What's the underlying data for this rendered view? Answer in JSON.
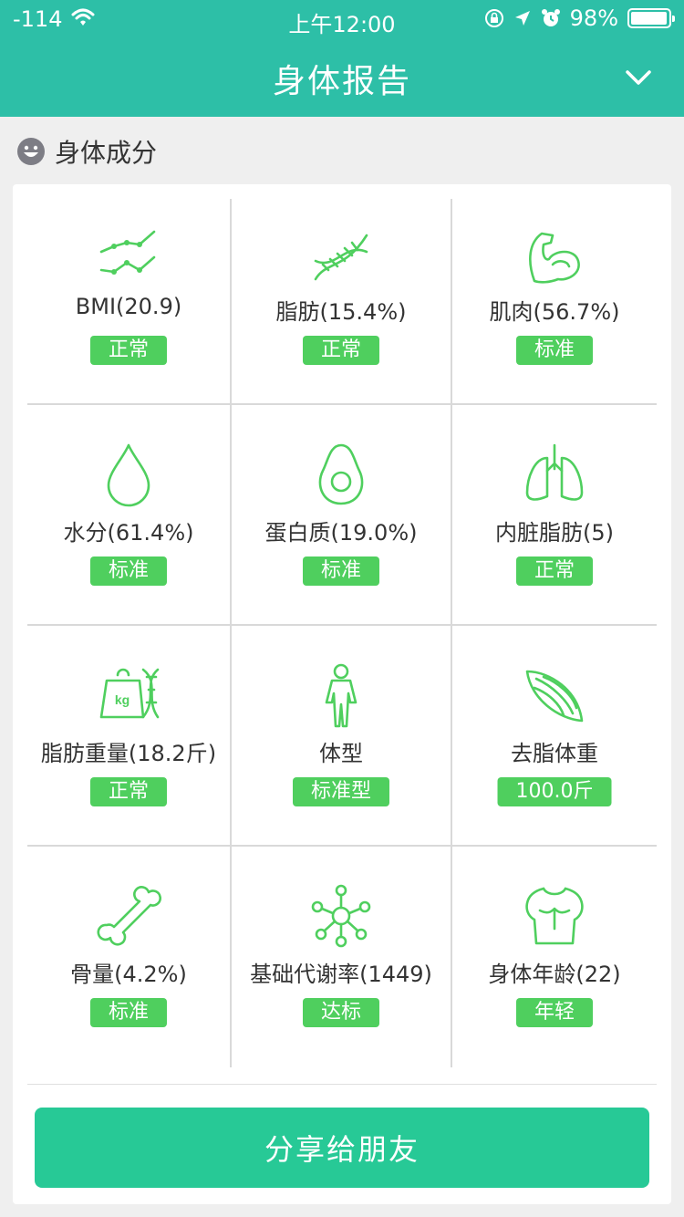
{
  "status_bar": {
    "signal": "-114",
    "time": "上午12:00",
    "battery": "98%",
    "battery_level": 0.98
  },
  "nav": {
    "title": "身体报告",
    "chevron_icon": "chevron-down-icon"
  },
  "section": {
    "icon": "smiley-face-icon",
    "title": "身体成分"
  },
  "metrics": [
    {
      "icon": "trend-lines-icon",
      "label": "BMI(20.9)",
      "badge": "正常"
    },
    {
      "icon": "dna-icon",
      "label": "脂肪(15.4%)",
      "badge": "正常"
    },
    {
      "icon": "muscle-arm-icon",
      "label": "肌肉(56.7%)",
      "badge": "标准"
    },
    {
      "icon": "water-drop-icon",
      "label": "水分(61.4%)",
      "badge": "标准"
    },
    {
      "icon": "avocado-icon",
      "label": "蛋白质(19.0%)",
      "badge": "标准"
    },
    {
      "icon": "lungs-icon",
      "label": "内脏脂肪(5)",
      "badge": "正常"
    },
    {
      "icon": "kg-weight-dna-icon",
      "label": "脂肪重量(18.2斤)",
      "badge": "正常",
      "icon_text": "kg"
    },
    {
      "icon": "body-figure-icon",
      "label": "体型",
      "badge": "标准型"
    },
    {
      "icon": "muscle-fiber-icon",
      "label": "去脂体重",
      "badge": "100.0斤"
    },
    {
      "icon": "bone-icon",
      "label": "骨量(4.2%)",
      "badge": "标准"
    },
    {
      "icon": "molecule-icon",
      "label": "基础代谢率(1449)",
      "badge": "达标"
    },
    {
      "icon": "torso-icon",
      "label": "身体年龄(22)",
      "badge": "年轻"
    }
  ],
  "share_button": {
    "label": "分享给朋友"
  },
  "colors": {
    "header": "#2dbfa7",
    "badge": "#4fcf5e",
    "icon": "#4fcf5e",
    "share_button": "#27c996",
    "background": "#efefef"
  }
}
